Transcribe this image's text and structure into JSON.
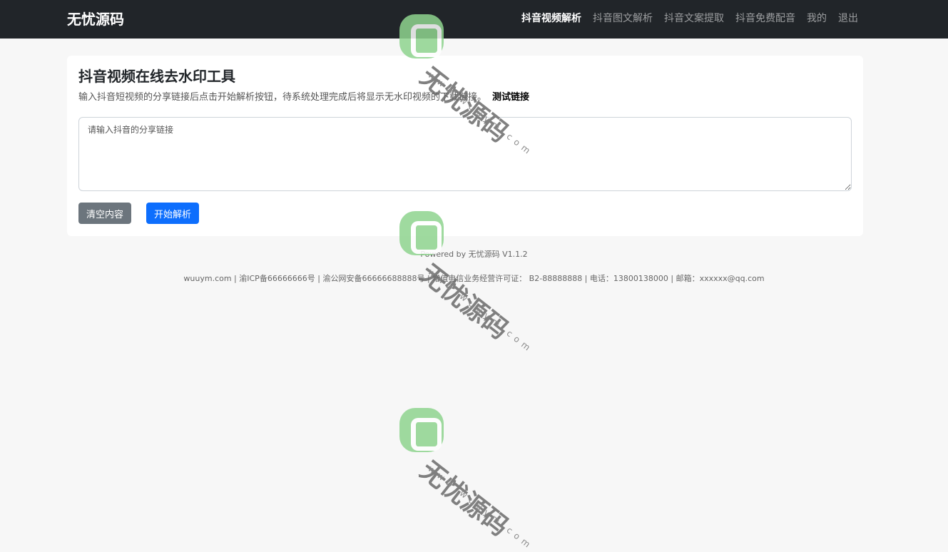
{
  "nav": {
    "brand": "无忧源码",
    "links": [
      {
        "label": "抖音视频解析",
        "active": true
      },
      {
        "label": "抖音图文解析",
        "active": false
      },
      {
        "label": "抖音文案提取",
        "active": false
      },
      {
        "label": "抖音免费配音",
        "active": false
      },
      {
        "label": "我的",
        "active": false
      },
      {
        "label": "退出",
        "active": false
      }
    ]
  },
  "card": {
    "title": "抖音视频在线去水印工具",
    "description": "输入抖音短视频的分享链接后点击开始解析按钮，待系统处理完成后将显示无水印视频的下载链接。",
    "test_link": "测试链接",
    "input_placeholder": "请输入抖音的分享链接",
    "input_value": "",
    "clear_button": "清空内容",
    "parse_button": "开始解析"
  },
  "footer": {
    "powered": "Powered by 无忧源码 V1.1.2",
    "info": "wuuym.com | 渝ICP备66666666号 | 渝公网安备66666688888号 | 增值电信业务经营许可证： B2-88888888 | 电话：13800138000 | 邮箱：xxxxxx@qq.com"
  },
  "watermark": {
    "text": "无忧源码",
    "url": "www.wuuym.com"
  },
  "colors": {
    "navbar_bg": "#212529",
    "primary": "#0d6efd",
    "secondary": "#6c757d",
    "page_bg": "#f7f7f7",
    "watermark_green": "#8fd48f"
  }
}
